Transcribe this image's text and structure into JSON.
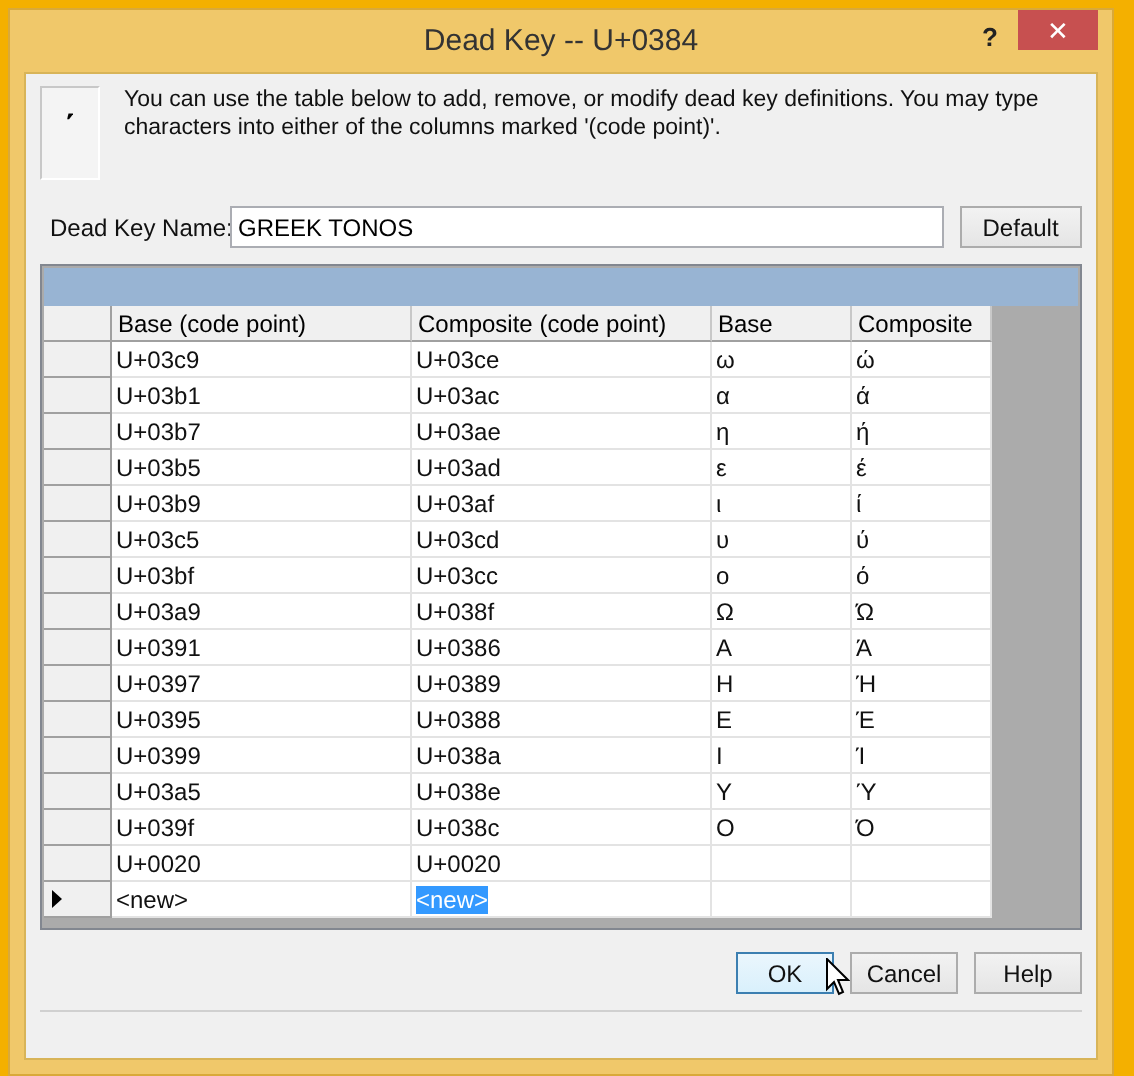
{
  "window": {
    "title": "Dead Key -- U+0384",
    "help": "?",
    "close": "✕"
  },
  "dead_key_glyph": "΄",
  "description": "You can use the table below to add, remove, or modify dead key definitions.  You may type characters into either of the columns marked '(code point)'.",
  "name_field": {
    "label": "Dead Key Name:",
    "value": "GREEK TONOS"
  },
  "default_button": "Default",
  "table": {
    "columns": [
      "Base  (code point)",
      "Composite (code point)",
      "Base",
      "Composite"
    ],
    "rows": [
      {
        "base_code": "U+03c9",
        "composite_code": "U+03ce",
        "base": "ω",
        "composite": "ώ",
        "selected": false
      },
      {
        "base_code": "U+03b1",
        "composite_code": "U+03ac",
        "base": "α",
        "composite": "ά",
        "selected": false
      },
      {
        "base_code": "U+03b7",
        "composite_code": "U+03ae",
        "base": "η",
        "composite": "ή",
        "selected": false
      },
      {
        "base_code": "U+03b5",
        "composite_code": "U+03ad",
        "base": "ε",
        "composite": "έ",
        "selected": false
      },
      {
        "base_code": "U+03b9",
        "composite_code": "U+03af",
        "base": "ι",
        "composite": "ί",
        "selected": false
      },
      {
        "base_code": "U+03c5",
        "composite_code": "U+03cd",
        "base": "υ",
        "composite": "ύ",
        "selected": false
      },
      {
        "base_code": "U+03bf",
        "composite_code": "U+03cc",
        "base": "ο",
        "composite": "ό",
        "selected": false
      },
      {
        "base_code": "U+03a9",
        "composite_code": "U+038f",
        "base": "Ω",
        "composite": "Ώ",
        "selected": false
      },
      {
        "base_code": "U+0391",
        "composite_code": "U+0386",
        "base": "Α",
        "composite": "Ά",
        "selected": false
      },
      {
        "base_code": "U+0397",
        "composite_code": "U+0389",
        "base": "Η",
        "composite": "Ή",
        "selected": false
      },
      {
        "base_code": "U+0395",
        "composite_code": "U+0388",
        "base": "Ε",
        "composite": "Έ",
        "selected": false
      },
      {
        "base_code": "U+0399",
        "composite_code": "U+038a",
        "base": "Ι",
        "composite": "Ί",
        "selected": false
      },
      {
        "base_code": "U+03a5",
        "composite_code": "U+038e",
        "base": "Υ",
        "composite": "Ύ",
        "selected": false
      },
      {
        "base_code": "U+039f",
        "composite_code": "U+038c",
        "base": "Ο",
        "composite": "Ό",
        "selected": false
      },
      {
        "base_code": "U+0020",
        "composite_code": "U+0020",
        "selected": false
      },
      {
        "base_code": "<new>",
        "composite_code": "<new>",
        "selected": true
      }
    ]
  },
  "buttons": [
    {
      "label": "OK",
      "kind": "default"
    },
    {
      "label": "Cancel",
      "kind": "normal"
    },
    {
      "label": "Help",
      "kind": "normal"
    }
  ]
}
